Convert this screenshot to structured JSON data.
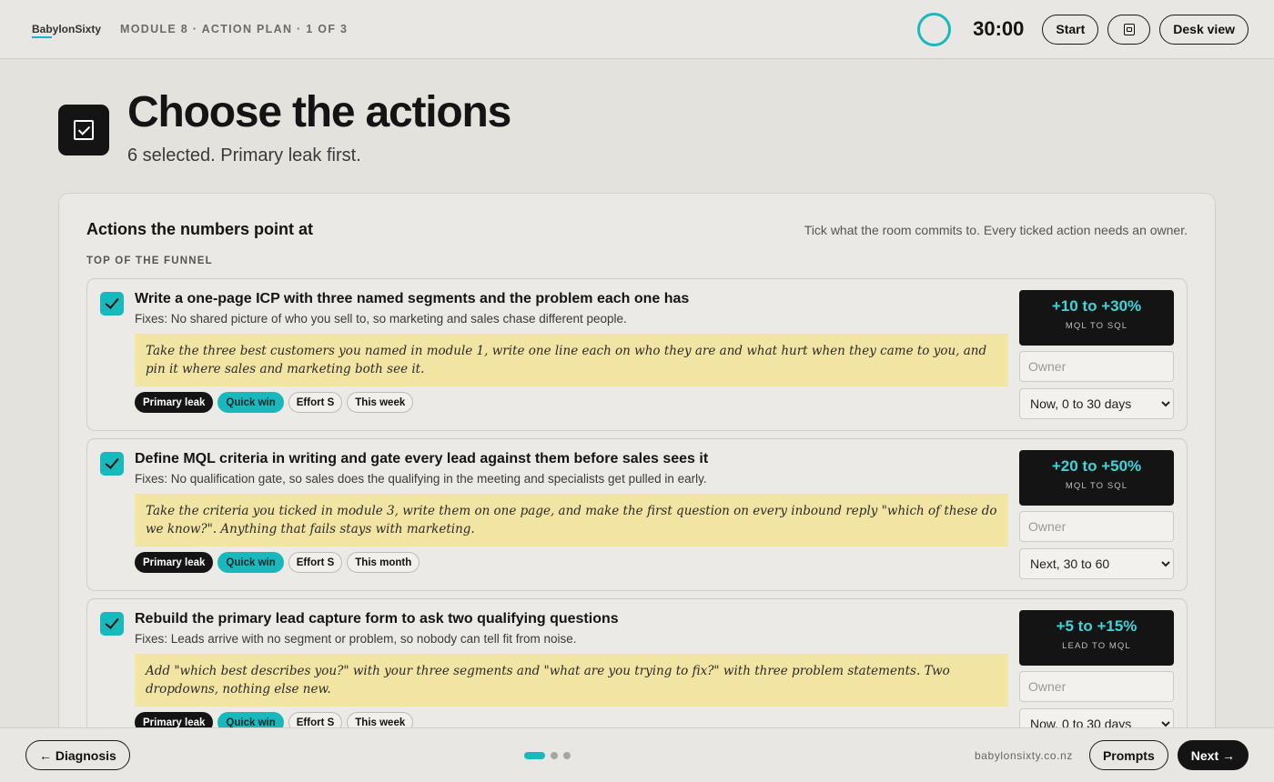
{
  "topbar": {
    "brand": "BabylonSixty",
    "crumb": "MODULE 8 · ACTION PLAN · 1 OF 3",
    "timer": "30:00",
    "start_label": "Start",
    "notes_icon": "notes-icon",
    "desk_view_label": "Desk view"
  },
  "header": {
    "title": "Choose the actions",
    "subtitle": "6 selected. Primary leak first."
  },
  "panel": {
    "title": "Actions the numbers point at",
    "hint": "Tick what the room commits to. Every ticked action needs an owner.",
    "section": "TOP OF THE FUNNEL",
    "actions": [
      {
        "checked": true,
        "title": "Write a one-page ICP with three named segments and the problem each one has",
        "fixes": "Fixes: No shared picture of who you sell to, so marketing and sales chase different people.",
        "note": "Take the three best customers you named in module 1, write one line each on who they are and what hurt when they came to you, and pin it where sales and marketing both see it.",
        "tags": [
          "Primary leak",
          "Quick win",
          "Effort S",
          "This week"
        ],
        "impact_range": "+10 to +30%",
        "impact_metric": "MQL TO SQL",
        "owner_placeholder": "Owner",
        "timing": "Now, 0 to 30 days"
      },
      {
        "checked": true,
        "title": "Define MQL criteria in writing and gate every lead against them before sales sees it",
        "fixes": "Fixes: No qualification gate, so sales does the qualifying in the meeting and specialists get pulled in early.",
        "note": "Take the criteria you ticked in module 3, write them on one page, and make the first question on every inbound reply \"which of these do we know?\". Anything that fails stays with marketing.",
        "tags": [
          "Primary leak",
          "Quick win",
          "Effort S",
          "This month"
        ],
        "impact_range": "+20 to +50%",
        "impact_metric": "MQL TO SQL",
        "owner_placeholder": "Owner",
        "timing": "Next, 30 to 60"
      },
      {
        "checked": true,
        "title": "Rebuild the primary lead capture form to ask two qualifying questions",
        "fixes": "Fixes: Leads arrive with no segment or problem, so nobody can tell fit from noise.",
        "note": "Add \"which best describes you?\" with your three segments and \"what are you trying to fix?\" with three problem statements. Two dropdowns, nothing else new.",
        "tags": [
          "Primary leak",
          "Quick win",
          "Effort S",
          "This week"
        ],
        "impact_range": "+5 to +15%",
        "impact_metric": "LEAD TO MQL",
        "owner_placeholder": "Owner",
        "timing": "Now, 0 to 30 days"
      }
    ]
  },
  "footer": {
    "back_label": "← Diagnosis",
    "pager": {
      "total": 3,
      "current": 1
    },
    "site": "babylonsixty.co.nz",
    "prompts_label": "Prompts",
    "next_label": "Next →"
  },
  "colors": {
    "accent": "#19b8bc",
    "dark": "#141414",
    "note_bg": "#f2e5a3",
    "page_bg": "#e4e2dd"
  }
}
